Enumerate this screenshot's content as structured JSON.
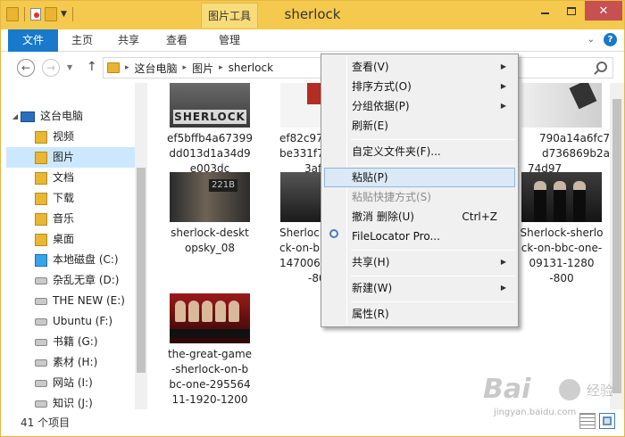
{
  "window": {
    "title": "sherlock",
    "contextual_tab": "图片工具",
    "close_glyph": "✕"
  },
  "ribbon": {
    "tabs": [
      "文件",
      "主页",
      "共享",
      "查看",
      "管理"
    ],
    "help_glyph": "?"
  },
  "address": {
    "crumbs": [
      "这台电脑",
      "图片",
      "sherlock"
    ]
  },
  "nav": {
    "items": [
      {
        "label": "这台电脑",
        "icon": "computer-icon"
      },
      {
        "label": "视频",
        "icon": "folder-icon"
      },
      {
        "label": "图片",
        "icon": "folder-icon",
        "selected": true
      },
      {
        "label": "文档",
        "icon": "folder-icon"
      },
      {
        "label": "下载",
        "icon": "download-folder-icon"
      },
      {
        "label": "音乐",
        "icon": "music-folder-icon"
      },
      {
        "label": "桌面",
        "icon": "folder-icon"
      },
      {
        "label": "本地磁盘 (C:)",
        "icon": "windows-drive-icon"
      },
      {
        "label": "杂乱无章 (D:)",
        "icon": "drive-icon"
      },
      {
        "label": "THE NEW (E:)",
        "icon": "drive-icon"
      },
      {
        "label": "Ubuntu (F:)",
        "icon": "drive-icon"
      },
      {
        "label": "书籍 (G:)",
        "icon": "drive-icon"
      },
      {
        "label": "素材 (H:)",
        "icon": "drive-icon"
      },
      {
        "label": "网站 (I:)",
        "icon": "drive-icon"
      },
      {
        "label": "知识 (J:)",
        "icon": "drive-icon"
      }
    ]
  },
  "files": [
    {
      "name": "ef5bffb4a67399dd013d1a34d9e003dc",
      "lines": [
        "ef5bffb4a67399",
        "dd013d1a34d9",
        "e003dc"
      ],
      "thumb_text": "SHERLOCK"
    },
    {
      "name": "ef82c978...be331f7...3af",
      "lines": [
        "ef82c978",
        "be331f7",
        "3af"
      ]
    },
    {
      "name": "790a14a6fc7...d736869b2a74d97",
      "lines": [
        "790a14a6fc7",
        "d736869b2a",
        "74d97"
      ]
    },
    {
      "name": "sherlock-desktopsky_08",
      "lines": [
        "sherlock-deskt",
        "opsky_08"
      ],
      "thumb_text": "221B"
    },
    {
      "name": "Sherlock-on-b...147006...-80",
      "lines": [
        "Sherlock",
        "ck-on-b",
        "147006",
        "-80"
      ]
    },
    {
      "name": "Sherlock-sherlock-on-bbc-one-09131-1280-800",
      "lines": [
        "Sherlock-sherlo",
        "ck-on-bbc-one-",
        "09131-1280",
        "-800"
      ]
    },
    {
      "name": "the-great-game-sherlock-on-bbc-one-29556411-1920-1200",
      "lines": [
        "the-great-game",
        "-sherlock-on-b",
        "bc-one-295564",
        "11-1920-1200"
      ]
    }
  ],
  "status": {
    "item_count": "41 个项目"
  },
  "context_menu": {
    "items": [
      {
        "label": "查看(V)",
        "submenu": true
      },
      {
        "label": "排序方式(O)",
        "submenu": true
      },
      {
        "label": "分组依据(P)",
        "submenu": true
      },
      {
        "label": "刷新(E)"
      },
      {
        "label": "自定义文件夹(F)..."
      },
      {
        "label": "粘贴(P)",
        "highlighted": true
      },
      {
        "label": "粘贴快捷方式(S)",
        "disabled": true
      },
      {
        "label": "撤消 删除(U)",
        "shortcut": "Ctrl+Z"
      },
      {
        "label": "FileLocator Pro...",
        "icon": "magnifier-icon"
      },
      {
        "label": "共享(H)",
        "submenu": true
      },
      {
        "label": "新建(W)",
        "submenu": true
      },
      {
        "label": "属性(R)"
      }
    ]
  },
  "watermark": {
    "logo": "Bai",
    "suffix": "经验",
    "url": "jingyan.baidu.com"
  },
  "colors": {
    "title_bar": "#f4c94e",
    "file_tab": "#1979ca",
    "selection": "#cce8ff",
    "close_button": "#c75050"
  }
}
